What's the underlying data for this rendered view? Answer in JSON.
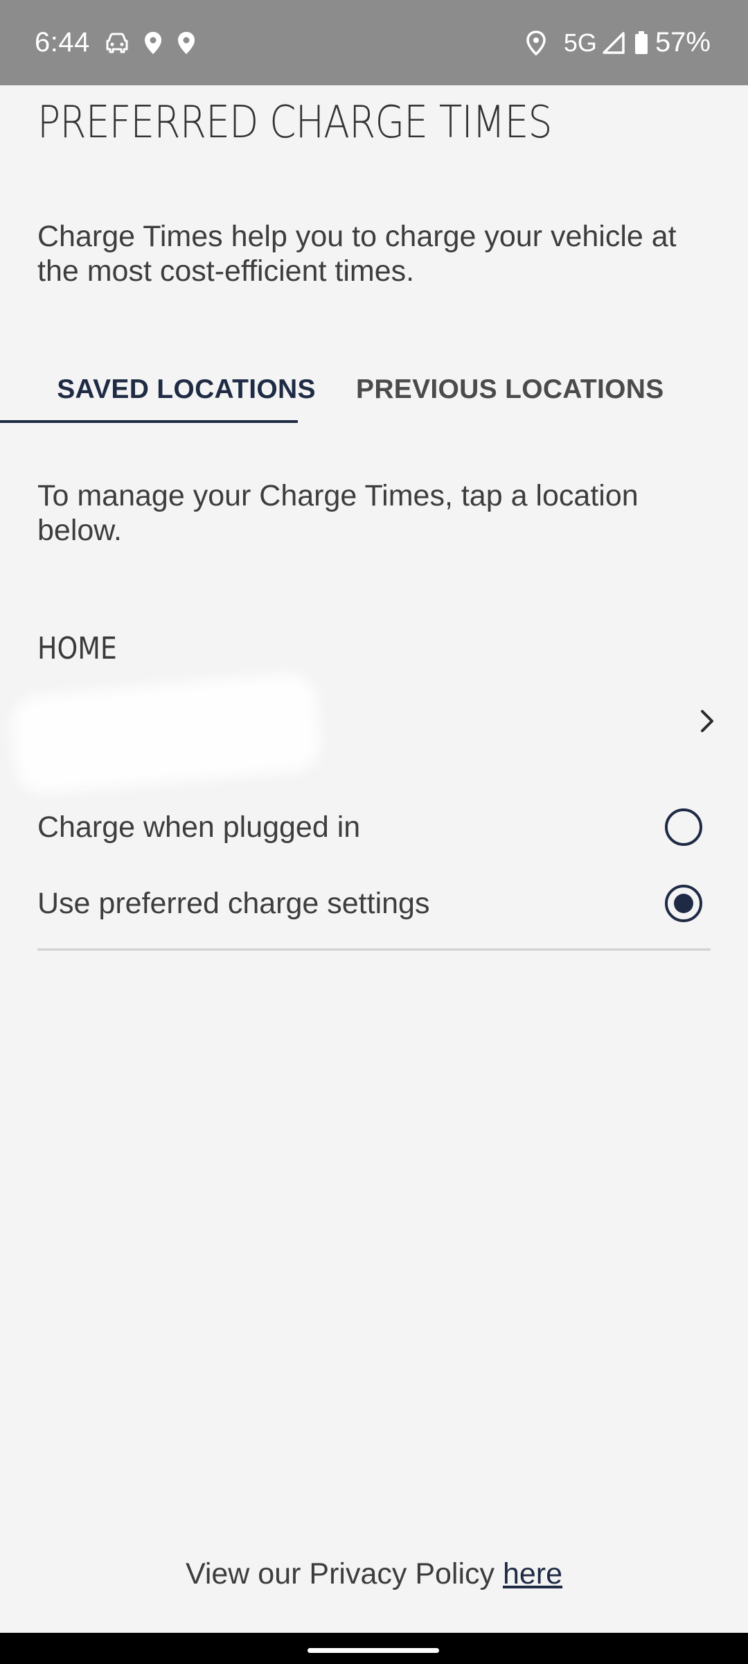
{
  "status_bar": {
    "time": "6:44",
    "left_icons": [
      "car-icon",
      "location-pin-icon",
      "location-pin-icon"
    ],
    "right_icons": [
      "location-outline-icon",
      "signal-icon",
      "battery-icon"
    ],
    "network": "5G",
    "battery": "57%"
  },
  "page": {
    "title": "PREFERRED CHARGE TIMES",
    "intro": "Charge Times help you to charge your vehicle at the most cost-efficient times."
  },
  "tabs": {
    "active": "saved",
    "saved": "SAVED LOCATIONS",
    "previous": "PREVIOUS LOCATIONS"
  },
  "manage_text": "To manage your Charge Times, tap a location below.",
  "location": {
    "section": "HOME",
    "address_redacted": true,
    "options": [
      {
        "label": "Charge when plugged in",
        "selected": false
      },
      {
        "label": "Use preferred charge settings",
        "selected": true
      }
    ]
  },
  "footer": {
    "privacy_prefix": "View our Privacy Policy ",
    "privacy_link": "here"
  },
  "colors": {
    "accent": "#1f2b45",
    "background": "#f4f4f4",
    "status_bar": "#8c8c8c"
  }
}
